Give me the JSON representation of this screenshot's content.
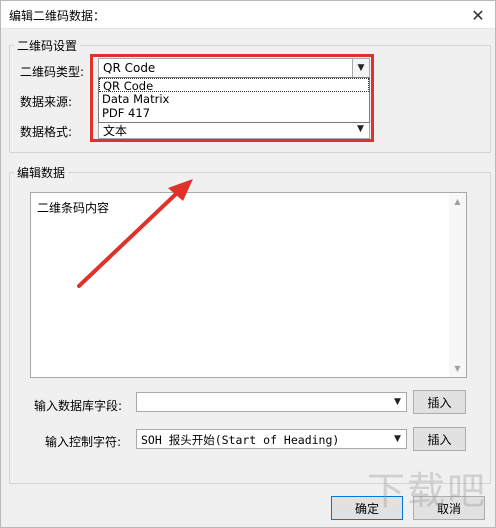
{
  "window": {
    "title": "编辑二维码数据："
  },
  "group_settings": {
    "legend": "二维码设置",
    "type_label": "二维码类型:",
    "type_value": "QR Code",
    "type_options": [
      "QR Code",
      "Data Matrix",
      "PDF 417"
    ],
    "source_label": "数据来源:",
    "format_label": "数据格式:",
    "format_value": "文本"
  },
  "group_edit": {
    "legend": "编辑数据",
    "content": "二维条码内容",
    "db_field_label": "输入数据库字段:",
    "db_field_value": "",
    "insert_label": "插入",
    "ctrl_char_label": "输入控制字符:",
    "ctrl_char_value": "SOH  报头开始(Start of Heading)",
    "insert2_label": "插入"
  },
  "footer": {
    "ok_label": "确定",
    "cancel_label": "取消"
  },
  "watermark": "下载吧",
  "colors": {
    "highlight": "#e0322a",
    "accent": "#0078d7"
  },
  "icons": {
    "close": "close-icon",
    "dropdown": "chevron-down-icon",
    "annotation": "red-arrow-icon"
  }
}
